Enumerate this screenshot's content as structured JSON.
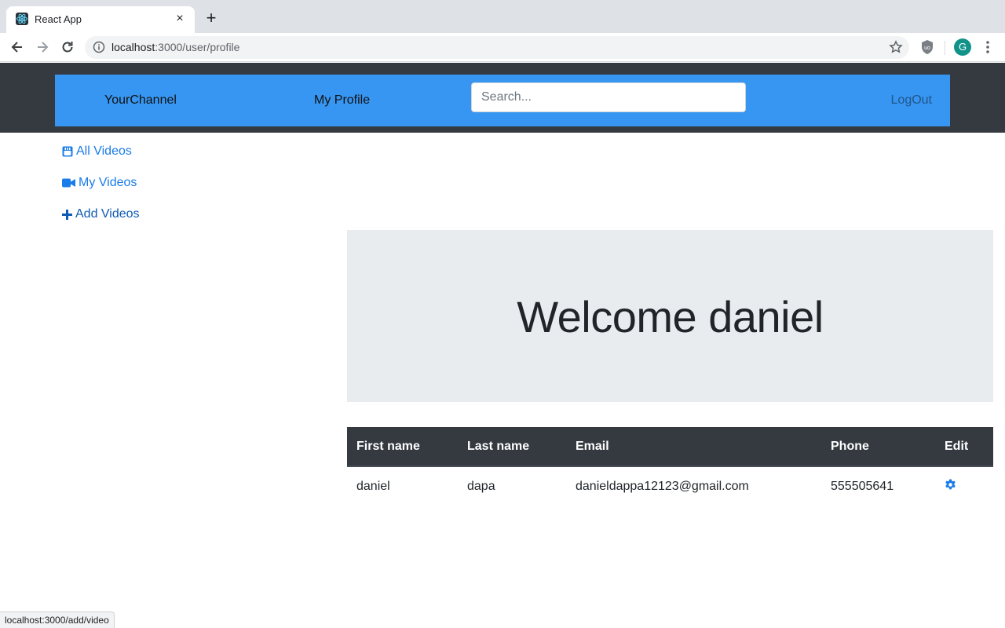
{
  "browser": {
    "tab_title": "React App",
    "tab_close": "×",
    "new_tab": "+",
    "url_host": "localhost",
    "url_path": ":3000/user/profile",
    "avatar_letter": "G",
    "status_url": "localhost:3000/add/video"
  },
  "navbar": {
    "brand": "YourChannel",
    "profile_link": "My Profile",
    "search_placeholder": "Search...",
    "logout": "LogOut",
    "bg_color": "#3796f2"
  },
  "sidebar": {
    "items": [
      {
        "label": "All Videos",
        "icon": "youtube-icon"
      },
      {
        "label": "My Videos",
        "icon": "video-camera-icon"
      },
      {
        "label": "Add Videos",
        "icon": "plus-icon"
      }
    ]
  },
  "jumbotron": {
    "title": "Welcome daniel"
  },
  "table": {
    "headers": [
      "First name",
      "Last name",
      "Email",
      "Phone",
      "Edit"
    ],
    "rows": [
      [
        "daniel",
        "dapa",
        "danieldappa12123@gmail.com",
        "555505641"
      ]
    ],
    "edit_icon": "gear-icon"
  }
}
